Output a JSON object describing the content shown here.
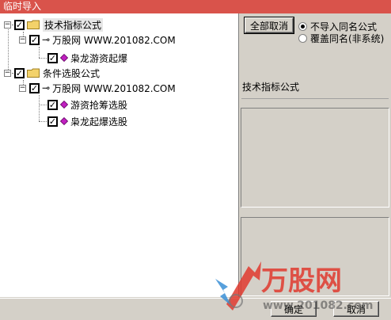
{
  "window": {
    "title": "临时导入"
  },
  "tree": {
    "groups": [
      {
        "label": "技术指标公式",
        "checked": true,
        "source": "万股网 WWW.201082.COM",
        "items": [
          "枭龙游资起爆"
        ]
      },
      {
        "label": "条件选股公式",
        "checked": true,
        "source": "万股网 WWW.201082.COM",
        "items": [
          "游资抢筹选股",
          "枭龙起爆选股"
        ]
      }
    ]
  },
  "controls": {
    "cancel_all_label": "全部取消",
    "radio_options": [
      {
        "label": "不导入同名公式",
        "selected": true
      },
      {
        "label": "覆盖同名(非系统)",
        "selected": false
      }
    ],
    "info_heading": "技术指标公式"
  },
  "footer": {
    "ok_label": "确定",
    "cancel_label": "取消"
  },
  "watermark": {
    "logo_text": "万股网",
    "site_text": "www.201082.com"
  },
  "colors": {
    "title_bar": "#d9534b",
    "folder": "#f3d26a",
    "gem": "#c020c0",
    "watermark_red": "#e03a2f"
  },
  "icons": {
    "expander": "minus-box-icon",
    "folder": "folder-icon",
    "key": "key-icon",
    "formula": "gem-icon"
  }
}
